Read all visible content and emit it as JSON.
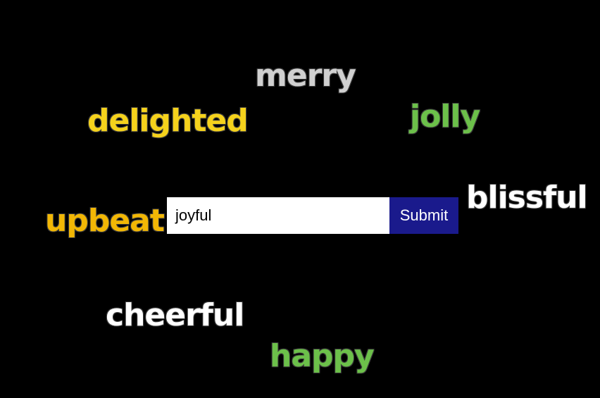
{
  "words": [
    {
      "text": "merry",
      "color": "#d0d0d0"
    },
    {
      "text": "delighted",
      "color": "#f5d21c"
    },
    {
      "text": "jolly",
      "color": "#6cc04a"
    },
    {
      "text": "blissful",
      "color": "#ffffff"
    },
    {
      "text": "upbeat",
      "color": "#f2b705"
    },
    {
      "text": "cheerful",
      "color": "#ffffff"
    },
    {
      "text": "happy",
      "color": "#6cc04a"
    }
  ],
  "form": {
    "input_value": "joyful",
    "submit_label": "Submit",
    "submit_color": "#1a1a8c"
  }
}
